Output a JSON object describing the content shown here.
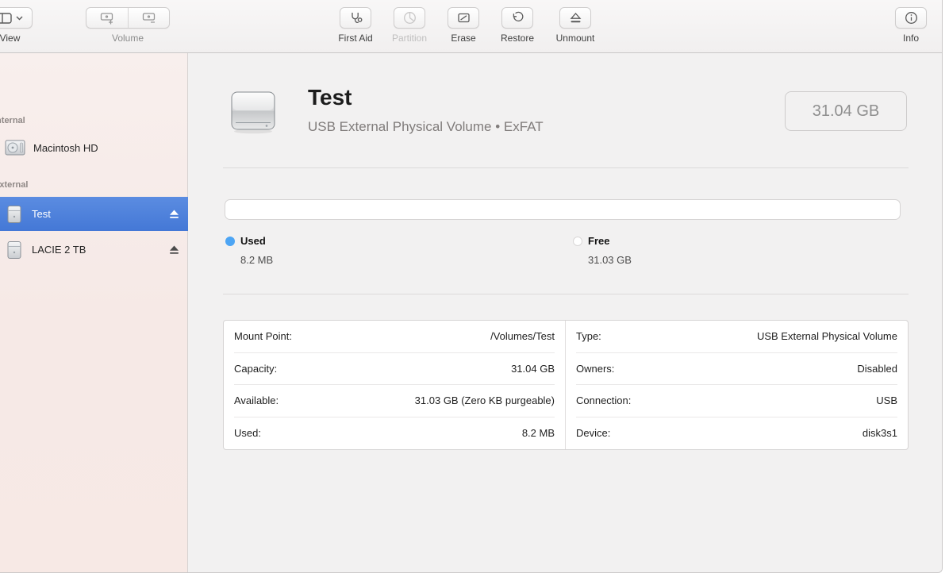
{
  "toolbar": {
    "view": {
      "label": "View"
    },
    "volume": {
      "label": "Volume"
    },
    "first_aid": {
      "label": "First Aid"
    },
    "partition": {
      "label": "Partition"
    },
    "erase": {
      "label": "Erase"
    },
    "restore": {
      "label": "Restore"
    },
    "unmount": {
      "label": "Unmount"
    },
    "info": {
      "label": "Info"
    }
  },
  "sidebar": {
    "sections": [
      {
        "label": "Internal",
        "items": [
          {
            "name": "Macintosh HD"
          }
        ]
      },
      {
        "label": "External",
        "items": [
          {
            "name": "Test",
            "selected": true
          },
          {
            "name": "LACIE 2 TB",
            "selected": false
          }
        ]
      }
    ]
  },
  "main": {
    "title": "Test",
    "subtitle": "USB External Physical Volume • ExFAT",
    "size_badge": "31.04 GB",
    "legend": [
      {
        "label": "Used",
        "value": "8.2 MB",
        "color": "#4da5f4"
      },
      {
        "label": "Free",
        "value": "31.03 GB",
        "color": "#ffffff"
      }
    ],
    "details_left": [
      {
        "label": "Mount Point:",
        "value": "/Volumes/Test"
      },
      {
        "label": "Capacity:",
        "value": "31.04 GB"
      },
      {
        "label": "Available:",
        "value": "31.03 GB (Zero KB purgeable)"
      },
      {
        "label": "Used:",
        "value": "8.2 MB"
      }
    ],
    "details_right": [
      {
        "label": "Type:",
        "value": "USB External Physical Volume"
      },
      {
        "label": "Owners:",
        "value": "Disabled"
      },
      {
        "label": "Connection:",
        "value": "USB"
      },
      {
        "label": "Device:",
        "value": "disk3s1"
      }
    ]
  },
  "colors": {
    "selection_blue": "#4a7fdb",
    "used_blue": "#4da5f4"
  }
}
